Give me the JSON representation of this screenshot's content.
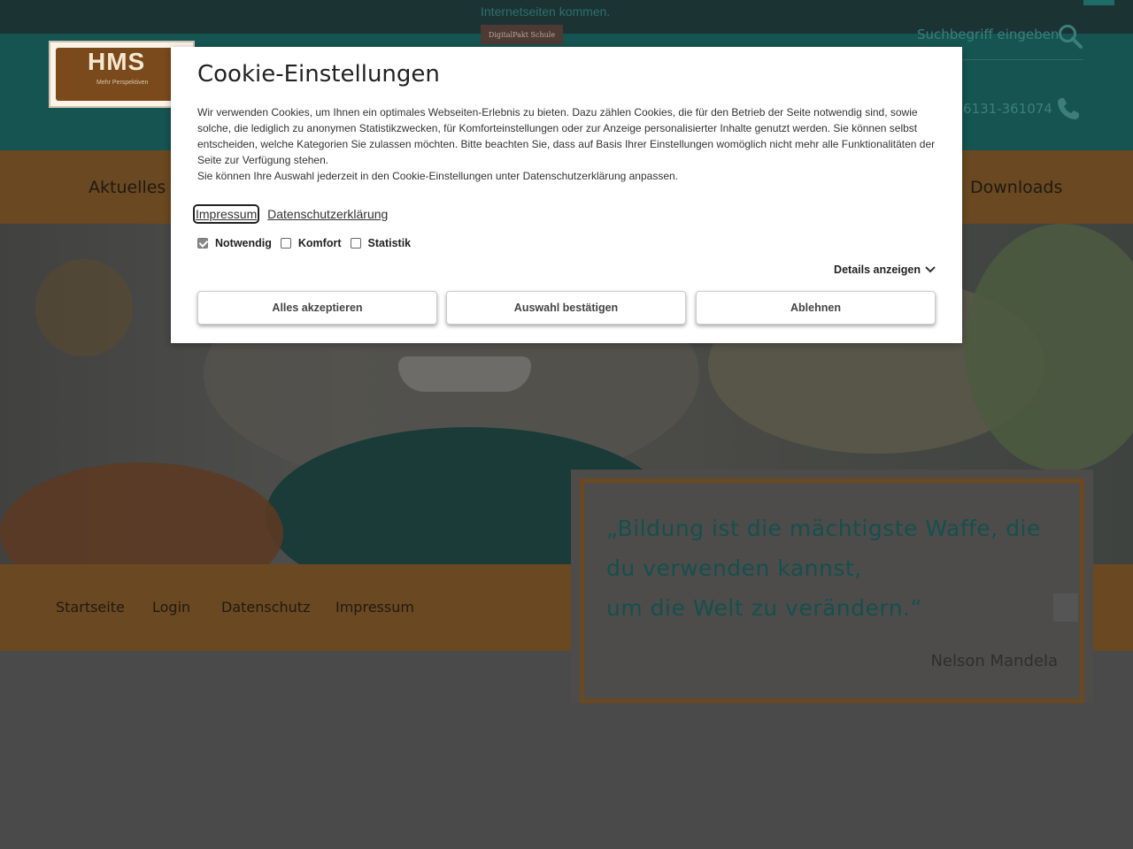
{
  "topbar": {
    "text": "Internetseiten kommen.",
    "button_label": "DigitalPakt Schule"
  },
  "header": {
    "logo_text": "HMS",
    "logo_sub": "Mehr Perspektiven",
    "search_placeholder": "Suchbegriff eingeben",
    "phone": "6131-361074"
  },
  "nav": {
    "items": [
      {
        "label": "Aktuelles"
      },
      {
        "label": "Downloads"
      }
    ]
  },
  "quote": {
    "line1": "„Bildung ist die mächtigste Waffe, die",
    "line2": "du verwenden kannst,",
    "line3": "um die Welt zu verändern.“",
    "author": "Nelson Mandela"
  },
  "footer": {
    "links": [
      {
        "label": "Startseite"
      },
      {
        "label": "Login"
      },
      {
        "label": "Datenschutz"
      },
      {
        "label": "Impressum"
      }
    ]
  },
  "cookie_modal": {
    "title": "Cookie-Einstellungen",
    "paragraph1": "Wir verwenden Cookies, um Ihnen ein optimales Webseiten-Erlebnis zu bieten. Dazu zählen Cookies, die für den Betrieb der Seite notwendig sind, sowie solche, die lediglich zu anonymen Statistikzwecken, für Komforteinstellungen oder zur Anzeige personalisierter Inhalte genutzt werden. Sie können selbst entscheiden, welche Kategorien Sie zulassen möchten. Bitte beachten Sie, dass auf Basis Ihrer Einstellungen womöglich nicht mehr alle Funktionalitäten der Seite zur Verfügung stehen.",
    "paragraph2": "Sie können Ihre Auswahl jederzeit in den Cookie-Einstellungen unter Datenschutzerklärung anpassen.",
    "links": {
      "impressum": "Impressum",
      "datenschutz": "Datenschutzerklärung"
    },
    "checkboxes": [
      {
        "label": "Notwendig",
        "checked": true
      },
      {
        "label": "Komfort",
        "checked": false
      },
      {
        "label": "Statistik",
        "checked": false
      }
    ],
    "details_label": "Details anzeigen",
    "buttons": {
      "accept_all": "Alles akzeptieren",
      "confirm": "Auswahl bestätigen",
      "reject": "Ablehnen"
    }
  },
  "colors": {
    "teal_dark": "#155451",
    "orange_dim": "#6a4821",
    "quote_text": "#14504d"
  }
}
